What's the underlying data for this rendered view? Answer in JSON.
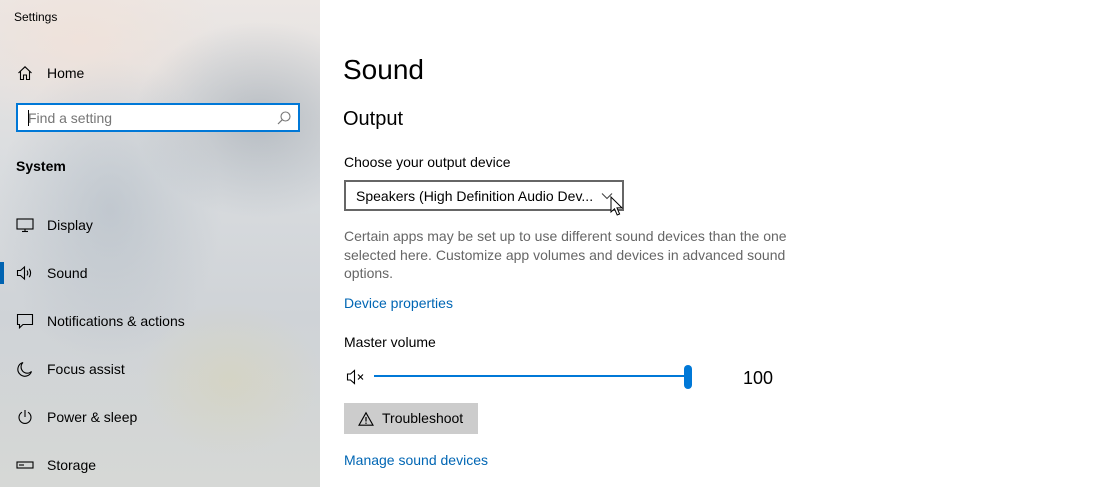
{
  "window": {
    "title": "Settings"
  },
  "sidebar": {
    "home_label": "Home",
    "search": {
      "placeholder": "Find a setting",
      "value": ""
    },
    "section": "System",
    "items": [
      {
        "label": "Display",
        "icon": "display-icon"
      },
      {
        "label": "Sound",
        "icon": "speaker-icon",
        "active": true
      },
      {
        "label": "Notifications & actions",
        "icon": "notification-icon"
      },
      {
        "label": "Focus assist",
        "icon": "moon-icon"
      },
      {
        "label": "Power & sleep",
        "icon": "power-icon"
      },
      {
        "label": "Storage",
        "icon": "storage-icon"
      }
    ]
  },
  "main": {
    "title": "Sound",
    "output": {
      "heading": "Output",
      "device_label": "Choose your output device",
      "device_value": "Speakers (High Definition Audio Dev...",
      "description": "Certain apps may be set up to use different sound devices than the one selected here. Customize app volumes and devices in advanced sound options.",
      "device_properties_link": "Device properties",
      "master_volume_label": "Master volume",
      "master_volume_value": "100",
      "troubleshoot_label": "Troubleshoot",
      "manage_devices_link": "Manage sound devices"
    }
  },
  "colors": {
    "accent": "#0078d7",
    "link": "#0066b4",
    "muted_text": "#666666",
    "button_bg": "#cccccc"
  }
}
